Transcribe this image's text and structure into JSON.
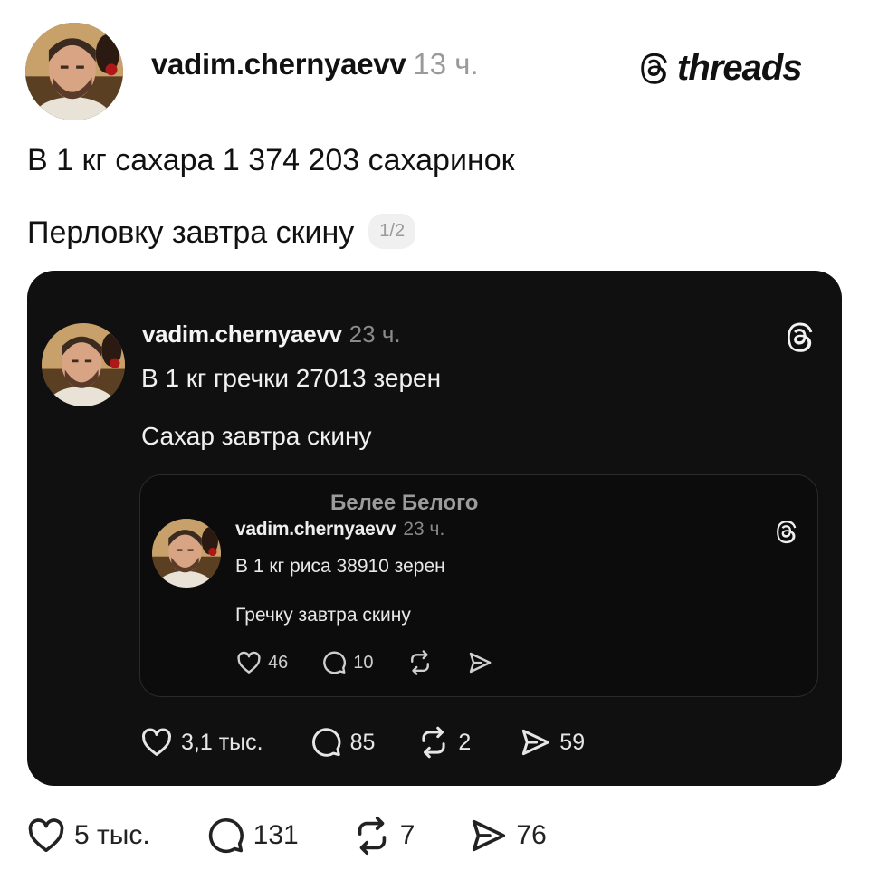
{
  "post": {
    "username": "vadim.chernyaevv",
    "time": "13 ч.",
    "brand": "threads",
    "text_line_1": "В 1 кг сахара 1 374 203 сахаринок",
    "text_line_2": "Перловку завтра скину",
    "page_indicator": "1/2",
    "actions": {
      "likes": "5 тыс.",
      "replies": "131",
      "reposts": "7",
      "shares": "76"
    }
  },
  "quoted": {
    "username": "vadim.chernyaevv",
    "time": "23 ч.",
    "text_line_1": "В 1 кг гречки 27013 зерен",
    "text_line_2": "Сахар завтра скину",
    "actions": {
      "likes": "3,1 тыс.",
      "replies": "85",
      "reposts": "2",
      "shares": "59"
    },
    "nested": {
      "watermark": "Белее Белого",
      "username": "vadim.chernyaevv",
      "time": "23 ч.",
      "text_line_1": "В 1 кг риса 38910 зерен",
      "text_line_2": "Гречку завтра скину",
      "actions": {
        "likes": "46",
        "replies": "10"
      }
    }
  },
  "icons": [
    "avatar-photo",
    "threads-logo-icon",
    "heart-icon",
    "comment-icon",
    "repost-icon",
    "share-icon"
  ],
  "colors": {
    "card_background": "#101010",
    "page_background": "#ffffff",
    "muted_text": "#9a9a9a"
  }
}
